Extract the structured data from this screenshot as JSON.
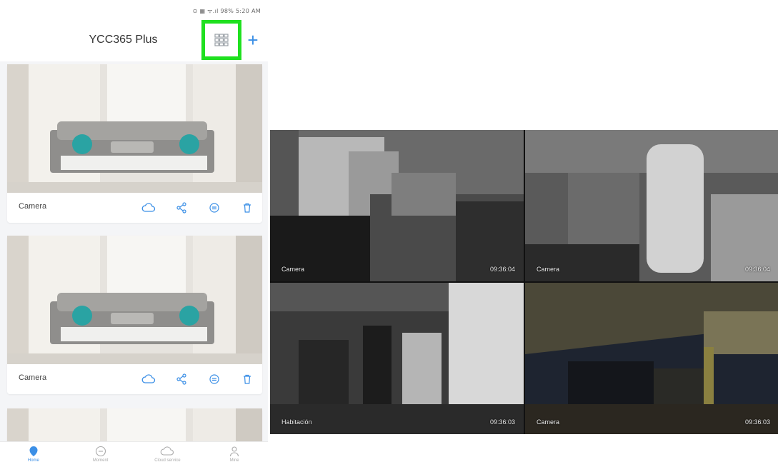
{
  "status_bar": {
    "text": "⊙ ▦ ᯤ.ıl 98% 5:20 AM"
  },
  "header": {
    "title": "YCC365 Plus",
    "add_label": "+"
  },
  "cameras": [
    {
      "name": "Camera"
    },
    {
      "name": "Camera"
    },
    {
      "name": ""
    }
  ],
  "bottom_nav": [
    {
      "label": "Home",
      "icon": "home-pin-icon",
      "active": true
    },
    {
      "label": "Moment",
      "icon": "moment-icon",
      "active": false
    },
    {
      "label": "Cloud service",
      "icon": "cloud-icon",
      "active": false
    },
    {
      "label": "Mine",
      "icon": "person-icon",
      "active": false
    }
  ],
  "multiview": {
    "tiles": [
      {
        "name": "Camera",
        "time": "09:36:04"
      },
      {
        "name": "Camera",
        "time": "09:36:04"
      },
      {
        "name": "Habitación",
        "time": "09:36:03"
      },
      {
        "name": "Camera",
        "time": "09:36:03"
      }
    ]
  },
  "colors": {
    "accent": "#3b8fe6",
    "highlight": "#1fe01f"
  }
}
